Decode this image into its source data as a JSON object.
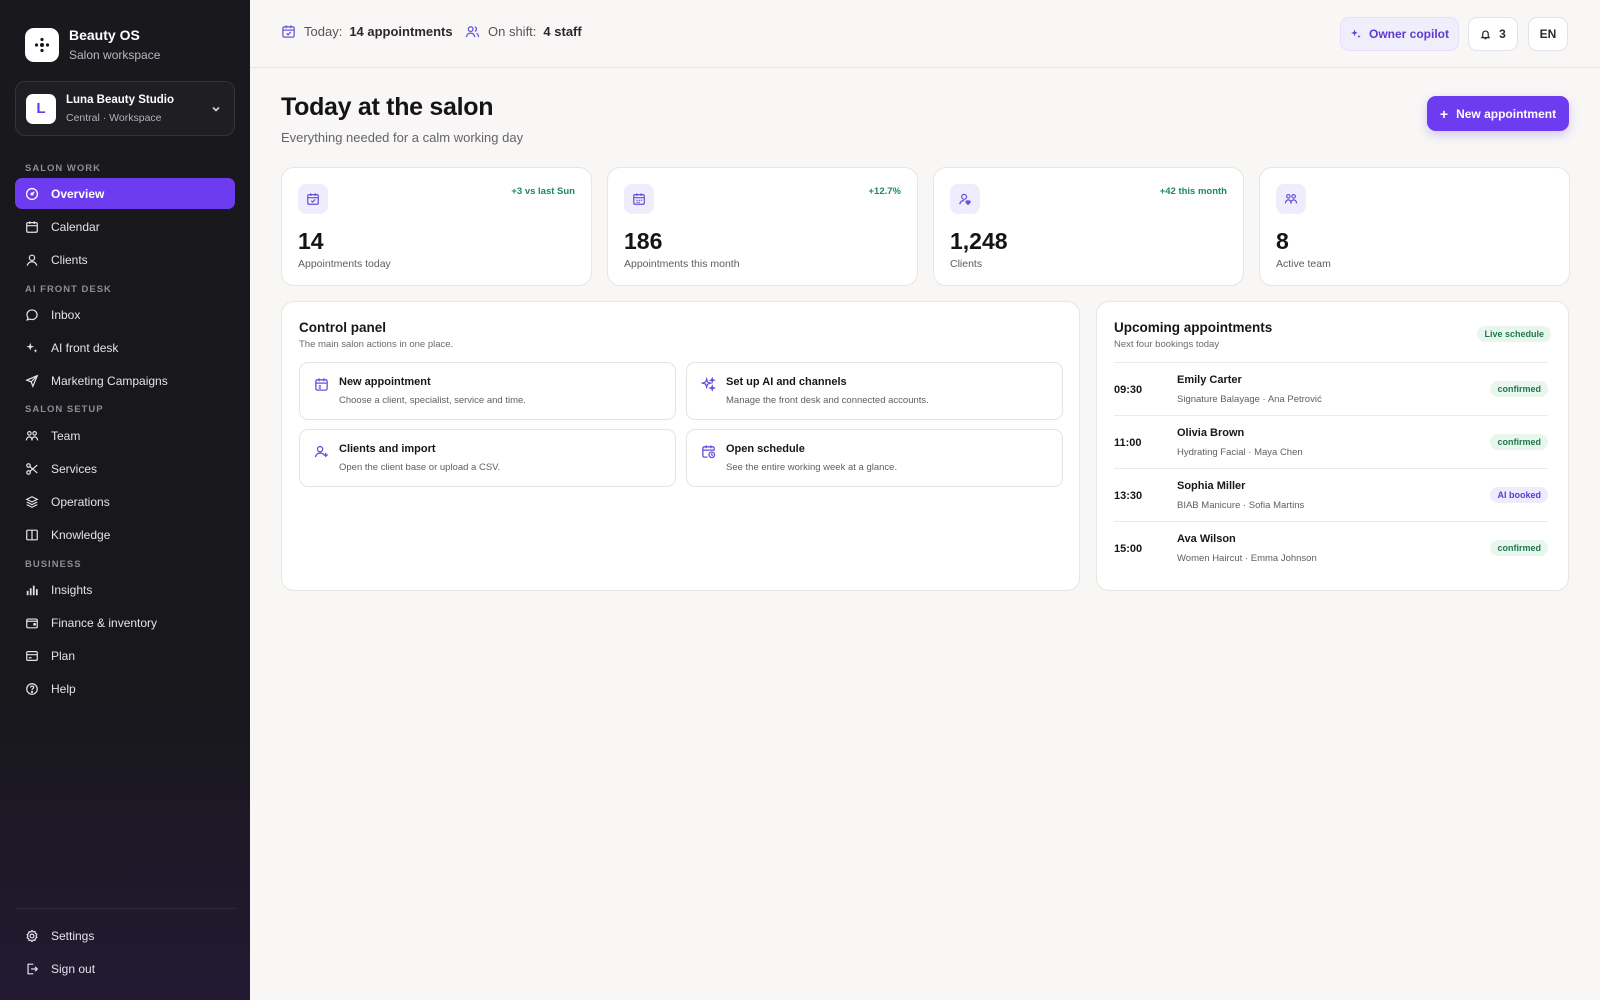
{
  "brand": {
    "name": "Beauty OS",
    "subtitle": "Salon workspace"
  },
  "workspace": {
    "initial": "L",
    "name": "Luna Beauty Studio",
    "subtitle": "Central · Workspace"
  },
  "nav": {
    "sections": [
      "SALON WORK",
      "AI FRONT DESK",
      "SALON SETUP",
      "BUSINESS"
    ],
    "items": [
      {
        "label": "Overview",
        "icon": "dashboard-icon",
        "active": true
      },
      {
        "label": "Calendar",
        "icon": "calendar-icon"
      },
      {
        "label": "Clients",
        "icon": "user-icon"
      },
      {
        "label": "Inbox",
        "icon": "chat-icon"
      },
      {
        "label": "AI front desk",
        "icon": "sparkles-icon"
      },
      {
        "label": "Marketing Campaigns",
        "icon": "send-icon"
      },
      {
        "label": "Team",
        "icon": "team-icon"
      },
      {
        "label": "Services",
        "icon": "scissors-icon"
      },
      {
        "label": "Operations",
        "icon": "layers-icon"
      },
      {
        "label": "Knowledge",
        "icon": "book-icon"
      },
      {
        "label": "Insights",
        "icon": "bar-chart-icon"
      },
      {
        "label": "Finance & inventory",
        "icon": "wallet-icon"
      },
      {
        "label": "Plan",
        "icon": "card-icon"
      },
      {
        "label": "Help",
        "icon": "help-icon"
      }
    ],
    "settings": "Settings",
    "signout": "Sign out"
  },
  "topbar": {
    "today_label": "Today:",
    "today_value": "14 appointments",
    "shift_label": "On shift:",
    "shift_value": "4 staff",
    "copilot": "Owner copilot",
    "notifications": "3",
    "language": "EN"
  },
  "header": {
    "title": "Today at the salon",
    "subtitle": "Everything needed for a calm working day",
    "new_appointment": "New appointment"
  },
  "stats": [
    {
      "value": "14",
      "label": "Appointments today",
      "delta": "+3 vs last Sun",
      "icon": "calendar-check-icon"
    },
    {
      "value": "186",
      "label": "Appointments this month",
      "delta": "+12.7%",
      "icon": "calendar-icon"
    },
    {
      "value": "1,248",
      "label": "Clients",
      "delta": "+42 this month",
      "icon": "user-heart-icon"
    },
    {
      "value": "8",
      "label": "Active team",
      "delta": "",
      "icon": "team-icon"
    }
  ],
  "control_panel": {
    "title": "Control panel",
    "subtitle": "The main salon actions in one place.",
    "actions": [
      {
        "title": "New appointment",
        "desc": "Choose a client, specialist, service and time.",
        "icon": "calendar-plus-icon"
      },
      {
        "title": "Set up AI and channels",
        "desc": "Manage the front desk and connected accounts.",
        "icon": "sparkles-icon"
      },
      {
        "title": "Clients and import",
        "desc": "Open the client base or upload a CSV.",
        "icon": "user-plus-icon"
      },
      {
        "title": "Open schedule",
        "desc": "See the entire working week at a glance.",
        "icon": "calendar-clock-icon"
      }
    ]
  },
  "upcoming": {
    "title": "Upcoming appointments",
    "subtitle": "Next four bookings today",
    "badge": "Live schedule",
    "rows": [
      {
        "time": "09:30",
        "name": "Emily Carter",
        "meta": "Signature Balayage · Ana Petrović",
        "status": "confirmed"
      },
      {
        "time": "11:00",
        "name": "Olivia Brown",
        "meta": "Hydrating Facial · Maya Chen",
        "status": "confirmed"
      },
      {
        "time": "13:30",
        "name": "Sophia Miller",
        "meta": "BIAB Manicure · Sofia Martins",
        "status": "AI booked"
      },
      {
        "time": "15:00",
        "name": "Ava Wilson",
        "meta": "Women Haircut · Emma Johnson",
        "status": "confirmed"
      }
    ]
  },
  "colors": {
    "accent": "#6d3cf0",
    "sidebar": "#19181c",
    "positive": "#1d8a5a"
  }
}
